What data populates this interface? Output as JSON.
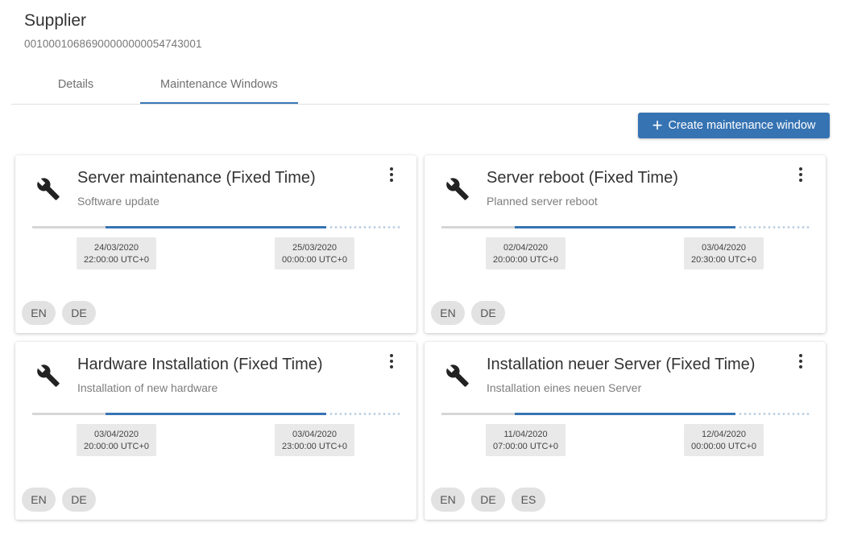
{
  "header": {
    "title": "Supplier",
    "id": "00100010686900000000054743001"
  },
  "tabs": [
    {
      "label": "Details",
      "active": false
    },
    {
      "label": "Maintenance Windows",
      "active": true
    }
  ],
  "actions": {
    "create_label": "Create maintenance window",
    "create_icon": "plus-icon",
    "accent_color": "#3673b3"
  },
  "cards": [
    {
      "icon": "wrench-icon",
      "title": "Server maintenance (Fixed Time)",
      "subtitle": "Software update",
      "start": {
        "date": "24/03/2020",
        "time": "22:00:00 UTC+0"
      },
      "end": {
        "date": "25/03/2020",
        "time": "00:00:00 UTC+0"
      },
      "languages": [
        "EN",
        "DE"
      ]
    },
    {
      "icon": "wrench-icon",
      "title": "Server reboot (Fixed Time)",
      "subtitle": "Planned server reboot",
      "start": {
        "date": "02/04/2020",
        "time": "20:00:00 UTC+0"
      },
      "end": {
        "date": "03/04/2020",
        "time": "20:30:00 UTC+0"
      },
      "languages": [
        "EN",
        "DE"
      ]
    },
    {
      "icon": "wrench-icon",
      "title": "Hardware Installation (Fixed Time)",
      "subtitle": "Installation of new hardware",
      "start": {
        "date": "03/04/2020",
        "time": "20:00:00 UTC+0"
      },
      "end": {
        "date": "03/04/2020",
        "time": "23:00:00 UTC+0"
      },
      "languages": [
        "EN",
        "DE"
      ]
    },
    {
      "icon": "wrench-icon",
      "title": "Installation neuer Server (Fixed Time)",
      "subtitle": "Installation eines neuen Server",
      "start": {
        "date": "11/04/2020",
        "time": "07:00:00 UTC+0"
      },
      "end": {
        "date": "12/04/2020",
        "time": "00:00:00 UTC+0"
      },
      "languages": [
        "EN",
        "DE",
        "ES"
      ]
    }
  ]
}
